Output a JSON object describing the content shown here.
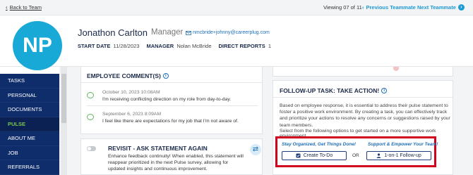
{
  "topbar": {
    "back_label": "Back to Team",
    "viewing": "Viewing 07 of 11",
    "prev_label": "Previous Teammate",
    "next_label": "Next Teammate"
  },
  "profile": {
    "initials": "NP",
    "name": "Jonathon Carlton",
    "role": "Manager",
    "email": "nmcbride+johnny@careerplug.com",
    "start_date_label": "START DATE",
    "start_date": "11/28/2023",
    "manager_label": "MANAGER",
    "manager": "Nolan McBride",
    "reports_label": "DIRECT REPORTS",
    "reports": "1"
  },
  "nav": {
    "items": [
      {
        "label": "TASKS"
      },
      {
        "label": "PERSONAL"
      },
      {
        "label": "DOCUMENTS"
      },
      {
        "label": "PULSE"
      },
      {
        "label": "ABOUT ME"
      },
      {
        "label": "JOB"
      },
      {
        "label": "REFERRALS"
      }
    ],
    "active": "PULSE"
  },
  "comments": {
    "title": "EMPLOYEE COMMENT(S)",
    "items": [
      {
        "date": "October 10, 2023 10:08AM",
        "text": "I'm receiving conflicting direction on my role from day-to-day."
      },
      {
        "date": "September 6, 2023 8:09AM",
        "text": "I feel like there are expectations for my job that I'm not aware of."
      }
    ]
  },
  "revisit": {
    "title": "REVISIT - ASK STATEMENT AGAIN",
    "description": "Enhance feedback continuity! When enabled, this statement will reappear prioritized in the next Pulse survey, allowing for updated insights and continuous improvement."
  },
  "followup": {
    "title": "FOLLOW-UP TASK: TAKE ACTION!",
    "body": "Based on employee response, it is essential to address their pulse statement to foster a positive work environment. By creating a task, you can effectively track and prioritize your actions to resolve any concerns or suggestions raised by your team members.",
    "prompt": "Select from the following options to get started on a more supportive work environment.",
    "left_heading": "Stay Organized, Get Things Done!",
    "right_heading": "Support & Empower Your Team!",
    "todo_label": "Create To-Do",
    "or_label": "OR",
    "oneonone_label": "1-on-1 Follow-up"
  },
  "colors": {
    "accent": "#1e9ad6",
    "nav_bg": "#0f2d6b",
    "active_nav": "#79c44a",
    "highlight_border": "#d0021b"
  },
  "icons": [
    "chevron-left-icon",
    "chevron-right-icon",
    "email-icon",
    "info-icon",
    "comment-icon",
    "toggle-icon",
    "refresh-icon",
    "checkbox-icon",
    "person-icon"
  ]
}
